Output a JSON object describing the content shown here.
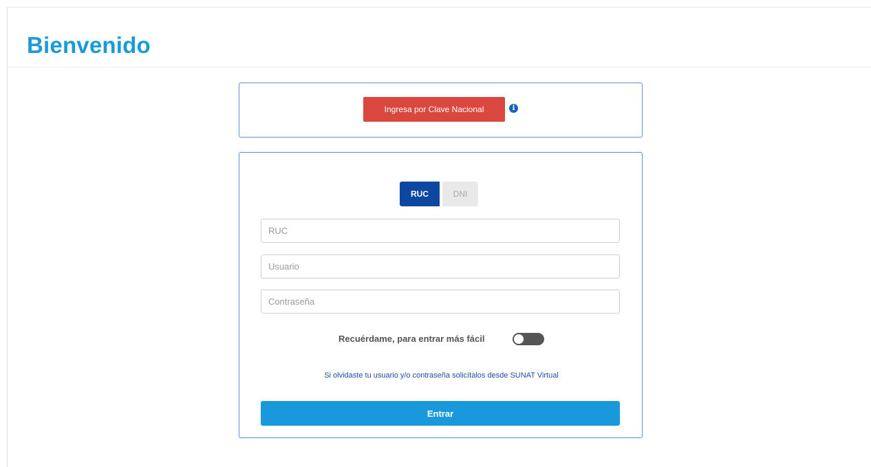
{
  "header": {
    "title": "Bienvenido"
  },
  "clave_nacional": {
    "button_label": "Ingresa por Clave Nacional",
    "info_icon": "info-circle-icon",
    "info_glyph": "i"
  },
  "login": {
    "tabs": [
      {
        "label": "RUC",
        "selected": true
      },
      {
        "label": "DNI",
        "selected": false
      }
    ],
    "fields": {
      "ruc_placeholder": "RUC",
      "user_placeholder": "Usuario",
      "password_placeholder": "Contraseña"
    },
    "remember_label": "Recuérdame, para entrar más fácil",
    "remember_on": false,
    "forgot_link": "Si olvidaste tu usuario y/o contraseña solicítalos desde SUNAT Virtual",
    "submit_label": "Entrar"
  },
  "colors": {
    "title": "#1a9ad6",
    "clave_button": "#d9473f",
    "tab_active": "#0d47a1",
    "submit_button": "#1998dc"
  }
}
